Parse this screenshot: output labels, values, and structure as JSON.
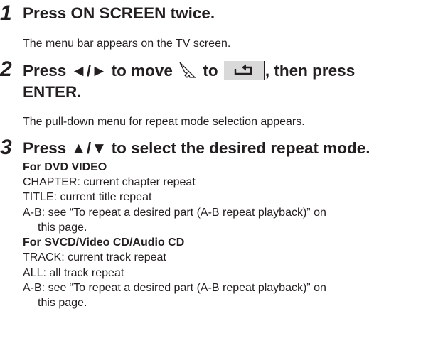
{
  "steps": [
    {
      "number": "1",
      "heading": "Press ON SCREEN twice.",
      "description": "The menu bar appears on the TV screen."
    },
    {
      "number": "2",
      "heading_part1": "Press ◄/► to move",
      "heading_part2": "to",
      "heading_part3": ", then press",
      "heading_line2": "ENTER.",
      "description": "The pull-down menu for repeat mode selection appears."
    },
    {
      "number": "3",
      "heading": "Press ▲/▼ to select the desired repeat mode."
    }
  ],
  "dvd": {
    "label": "For DVD VIDEO",
    "items": [
      "CHAPTER: current chapter repeat",
      "TITLE: current title repeat",
      "A-B: see “To repeat a desired part (A-B repeat playback)” on"
    ],
    "continuation": "this page."
  },
  "cd": {
    "label": "For SVCD/Video CD/Audio CD",
    "items": [
      "TRACK: current track repeat",
      "ALL: all track repeat",
      "A-B: see “To repeat a desired part (A-B repeat playback)” on"
    ],
    "continuation": "this page."
  },
  "icons": [
    "cursor-arrow-icon",
    "repeat-icon"
  ]
}
